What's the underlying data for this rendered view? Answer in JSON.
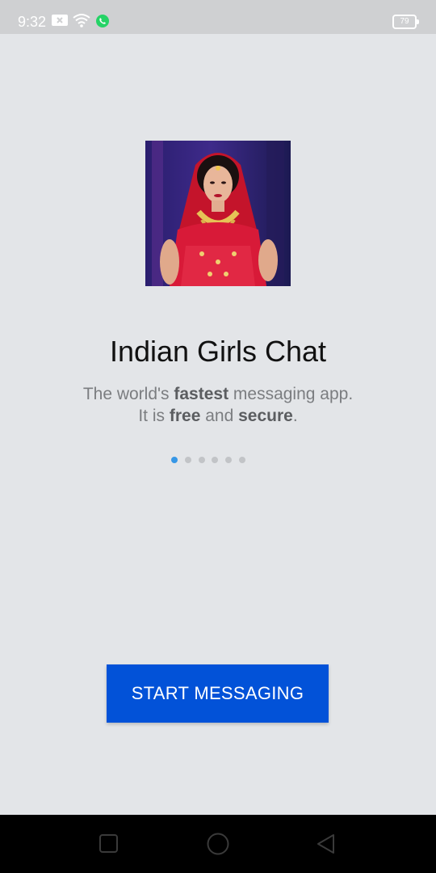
{
  "status_bar": {
    "time": "9:32",
    "battery_level": "79",
    "icons": [
      "notification-icon",
      "wifi-icon",
      "whatsapp-icon"
    ]
  },
  "onboarding": {
    "title": "Indian Girls Chat",
    "subtitle_line1_parts": [
      "The world's ",
      "fastest",
      " messaging app."
    ],
    "subtitle_line2_parts": [
      "It is ",
      "free",
      " and ",
      "secure",
      "."
    ],
    "page_count": 6,
    "active_page": 0,
    "start_label": "START MESSAGING"
  },
  "colors": {
    "background": "#e3e5e8",
    "accent_button": "#0252d8",
    "active_dot": "#3797e6"
  },
  "nav_bar": {
    "buttons": [
      "recents-icon",
      "home-icon",
      "back-icon"
    ]
  }
}
